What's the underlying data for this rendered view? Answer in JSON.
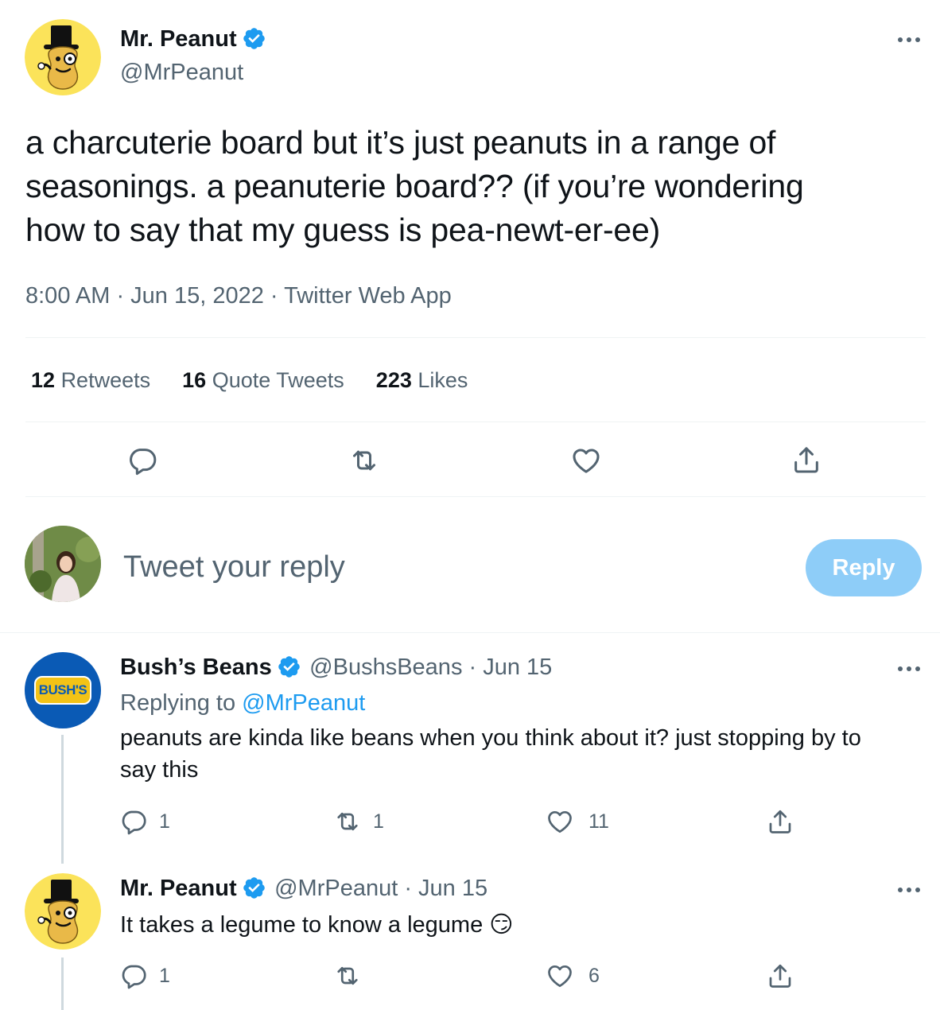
{
  "tweet": {
    "author_name": "Mr. Peanut",
    "author_handle": "@MrPeanut",
    "text_line1": "a charcuterie board but it’s just peanuts in a range of",
    "text_line2": "seasonings. a peanuterie board?? (if you’re wondering",
    "text_line3": "how to say that my guess is pea-newt-er-ee)",
    "timestamp": "8:00 AM · Jun 15, 2022 · Twitter Web App",
    "stats": {
      "retweets_count": "12",
      "retweets_label": "Retweets",
      "quotes_count": "16",
      "quotes_label": "Quote Tweets",
      "likes_count": "223",
      "likes_label": "Likes"
    }
  },
  "composer": {
    "placeholder": "Tweet your reply",
    "button_label": "Reply"
  },
  "replies": [
    {
      "author_name": "Bush’s Beans",
      "meta": "@BushsBeans · Jun 15",
      "replying_to_label": "Replying to",
      "replying_to_handle": "@MrPeanut",
      "text_line1": "peanuts are kinda like beans when you think about it? just stopping by to",
      "text_line2": "say this",
      "reply_count": "1",
      "retweet_count": "1",
      "like_count": "11",
      "avatar_text": "BUSH'S"
    },
    {
      "author_name": "Mr. Peanut",
      "meta": "@MrPeanut · Jun 15",
      "text": "It takes a legume to know a legume",
      "emoji": "😏",
      "reply_count": "1",
      "retweet_count": "",
      "like_count": "6"
    }
  ],
  "colors": {
    "accent": "#1d9bf0",
    "reply_button": "#8ecdf8",
    "secondary_text": "#536471",
    "divider": "#eff3f4"
  },
  "icons": [
    "more-icon",
    "verified-badge-icon",
    "reply-icon",
    "retweet-icon",
    "like-icon",
    "share-icon"
  ]
}
